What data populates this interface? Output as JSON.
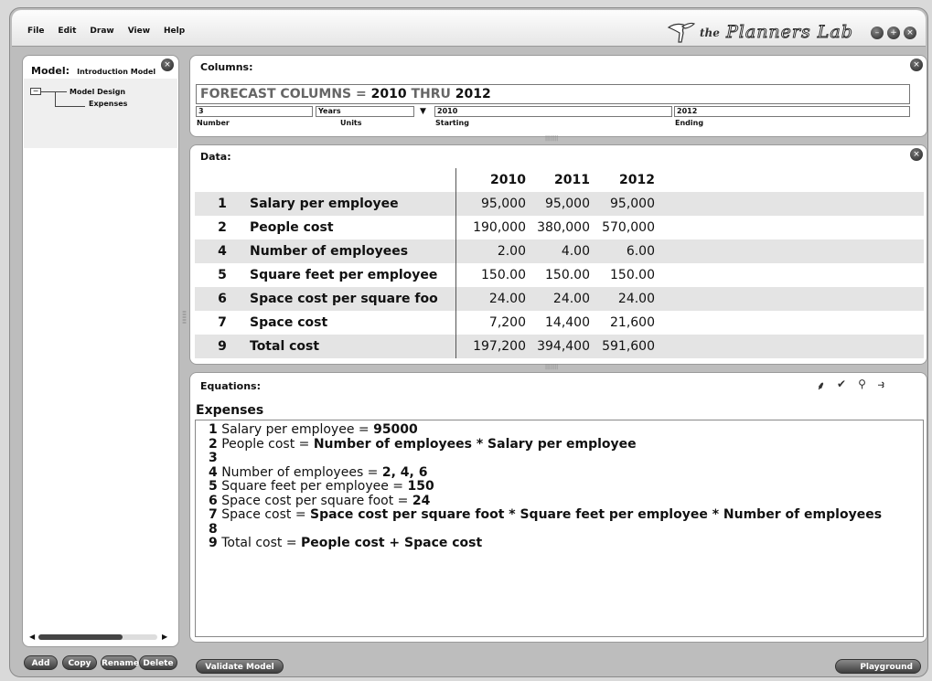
{
  "app": {
    "menu": [
      "File",
      "Edit",
      "Draw",
      "View",
      "Help"
    ],
    "brand_prefix": "the",
    "brand_name": "Planners Lab",
    "window_buttons": [
      "minimize-icon",
      "maximize-icon",
      "close-icon"
    ]
  },
  "model": {
    "label": "Model:",
    "name": "Introduction Model",
    "tree": {
      "root": "Model Design",
      "child": "Expenses"
    },
    "buttons": [
      "Add",
      "Copy",
      "Rename",
      "Delete"
    ]
  },
  "columns": {
    "title": "Columns:",
    "forecast_parts": [
      "FORECAST COLUMNS = ",
      "2010",
      " THRU ",
      "2012"
    ],
    "number_value": "3",
    "number_label": "Number",
    "units_value": "Years",
    "units_label": "Units",
    "starting_value": "2010",
    "starting_label": "Starting",
    "ending_value": "2012",
    "ending_label": "Ending"
  },
  "data": {
    "title": "Data:",
    "headers": [
      "2010",
      "2011",
      "2012"
    ],
    "rows": [
      {
        "num": "1",
        "label": "Salary per employee",
        "values": [
          "95,000",
          "95,000",
          "95,000"
        ]
      },
      {
        "num": "2",
        "label": "People cost",
        "values": [
          "190,000",
          "380,000",
          "570,000"
        ]
      },
      {
        "num": "4",
        "label": "Number of employees",
        "values": [
          "2.00",
          "4.00",
          "6.00"
        ]
      },
      {
        "num": "5",
        "label": "Square feet per employee",
        "values": [
          "150.00",
          "150.00",
          "150.00"
        ]
      },
      {
        "num": "6",
        "label": "Space cost per square foo",
        "values": [
          "24.00",
          "24.00",
          "24.00"
        ]
      },
      {
        "num": "7",
        "label": "Space cost",
        "values": [
          "7,200",
          "14,400",
          "21,600"
        ]
      },
      {
        "num": "9",
        "label": "Total cost",
        "values": [
          "197,200",
          "394,400",
          "591,600"
        ]
      }
    ]
  },
  "equations": {
    "title": "Equations:",
    "heading": "Expenses",
    "tools": [
      "wand-icon",
      "check-icon",
      "search-icon",
      "zoom-arrow-icon"
    ],
    "lines": [
      {
        "num": "1",
        "lhs": "Salary per employee = ",
        "rhs": "95000"
      },
      {
        "num": "2",
        "lhs": "People cost = ",
        "rhs": "Number of employees * Salary per employee"
      },
      {
        "num": "3",
        "lhs": "",
        "rhs": ""
      },
      {
        "num": "4",
        "lhs": "Number of employees = ",
        "rhs": "2, 4, 6"
      },
      {
        "num": "5",
        "lhs": "Square feet per employee = ",
        "rhs": "150"
      },
      {
        "num": "6",
        "lhs": "Space cost per square foot = ",
        "rhs": "24"
      },
      {
        "num": "7",
        "lhs": "Space cost = ",
        "rhs": "Space cost per square foot * Square feet per employee * Number of employees"
      },
      {
        "num": "8",
        "lhs": "",
        "rhs": ""
      },
      {
        "num": "9",
        "lhs": "Total cost = ",
        "rhs": "People cost + Space cost"
      }
    ]
  },
  "footer": {
    "validate": "Validate Model",
    "playground": "Playground"
  }
}
